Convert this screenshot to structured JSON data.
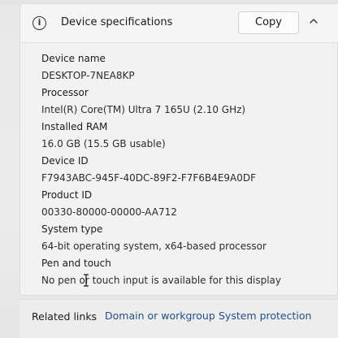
{
  "header": {
    "info_icon": "info-icon",
    "title": "Device specifications",
    "copy_label": "Copy",
    "chevron_icon": "chevron-up-icon"
  },
  "specs": [
    {
      "label": "Device name",
      "value": "DESKTOP-7NEA8KP"
    },
    {
      "label": "Processor",
      "value": "Intel(R) Core(TM) Ultra 7 165U (2.10 GHz)"
    },
    {
      "label": "Installed RAM",
      "value": "16.0 GB (15.5 GB usable)"
    },
    {
      "label": "Device ID",
      "value": "F7943ABC-945F-40DC-89F2-F7F6B4E9A0DF"
    },
    {
      "label": "Product ID",
      "value": "00330-80000-00000-AA712"
    },
    {
      "label": "System type",
      "value": "64-bit operating system, x64-based processor"
    },
    {
      "label": "Pen and touch",
      "value": "No pen or touch input is available for this display"
    }
  ],
  "related": {
    "label": "Related links",
    "links": [
      "Domain or workgroup",
      "System protection"
    ]
  },
  "colors": {
    "link": "#1f4f8a",
    "card_bg": "#f2f2f2",
    "page_bg": "#e9e9e9"
  }
}
